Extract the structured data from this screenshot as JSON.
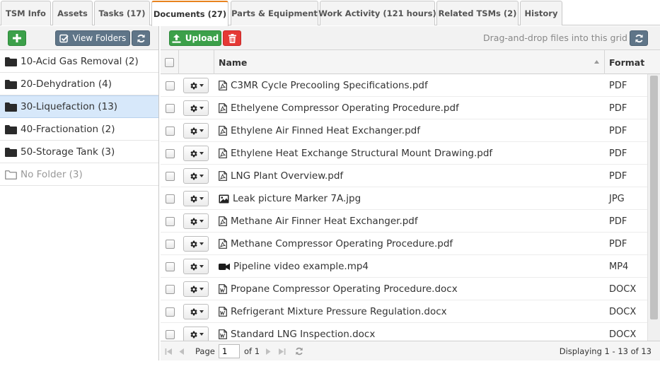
{
  "tabs": [
    {
      "label": "TSM Info"
    },
    {
      "label": "Assets"
    },
    {
      "label": "Tasks (17)"
    },
    {
      "label": "Documents (27)"
    },
    {
      "label": "Parts & Equipment"
    },
    {
      "label": "Work Activity (121 hours)"
    },
    {
      "label": "Related TSMs (2)"
    },
    {
      "label": "History"
    }
  ],
  "left_toolbar": {
    "view_folders_label": "View Folders"
  },
  "folders": [
    {
      "label": "10-Acid Gas Removal (2)"
    },
    {
      "label": "20-Dehydration (4)"
    },
    {
      "label": "30-Liquefaction (13)",
      "selected": true
    },
    {
      "label": "40-Fractionation (2)"
    },
    {
      "label": "50-Storage Tank (3)"
    },
    {
      "label": "No Folder (3)",
      "muted": true
    }
  ],
  "right_toolbar": {
    "upload_label": "Upload",
    "dnd_hint": "Drag-and-drop files into this grid"
  },
  "grid": {
    "columns": {
      "name": "Name",
      "format": "Format"
    },
    "rows": [
      {
        "name": "C3MR Cycle Precooling Specifications.pdf",
        "format": "PDF",
        "icon": "pdf-file-icon"
      },
      {
        "name": "Ethelyene Compressor Operating Procedure.pdf",
        "format": "PDF",
        "icon": "pdf-file-icon"
      },
      {
        "name": "Ethylene Air Finned Heat Exchanger.pdf",
        "format": "PDF",
        "icon": "pdf-file-icon"
      },
      {
        "name": "Ethylene Heat Exchange Structural Mount Drawing.pdf",
        "format": "PDF",
        "icon": "pdf-file-icon"
      },
      {
        "name": "LNG Plant Overview.pdf",
        "format": "PDF",
        "icon": "pdf-file-icon"
      },
      {
        "name": "Leak picture Marker 7A.jpg",
        "format": "JPG",
        "icon": "image-file-icon"
      },
      {
        "name": "Methane Air Finner Heat Exchanger.pdf",
        "format": "PDF",
        "icon": "pdf-file-icon"
      },
      {
        "name": "Methane Compressor Operating Procedure.pdf",
        "format": "PDF",
        "icon": "pdf-file-icon"
      },
      {
        "name": "Pipeline video example.mp4",
        "format": "MP4",
        "icon": "video-file-icon"
      },
      {
        "name": "Propane Compressor Operating Procedure.docx",
        "format": "DOCX",
        "icon": "word-file-icon"
      },
      {
        "name": "Refrigerant Mixture Pressure Regulation.docx",
        "format": "DOCX",
        "icon": "word-file-icon"
      },
      {
        "name": "Standard LNG Inspection.docx",
        "format": "DOCX",
        "icon": "word-file-icon"
      }
    ]
  },
  "pager": {
    "page_label": "Page",
    "page_value": "1",
    "of_label": "of 1",
    "displaying": "Displaying 1 - 13 of 13"
  },
  "colors": {
    "accent_tab": "#e8821e",
    "green": "#3ca04a",
    "slate": "#5f7588",
    "red": "#e53935",
    "selected_row": "#d7e8fa"
  }
}
